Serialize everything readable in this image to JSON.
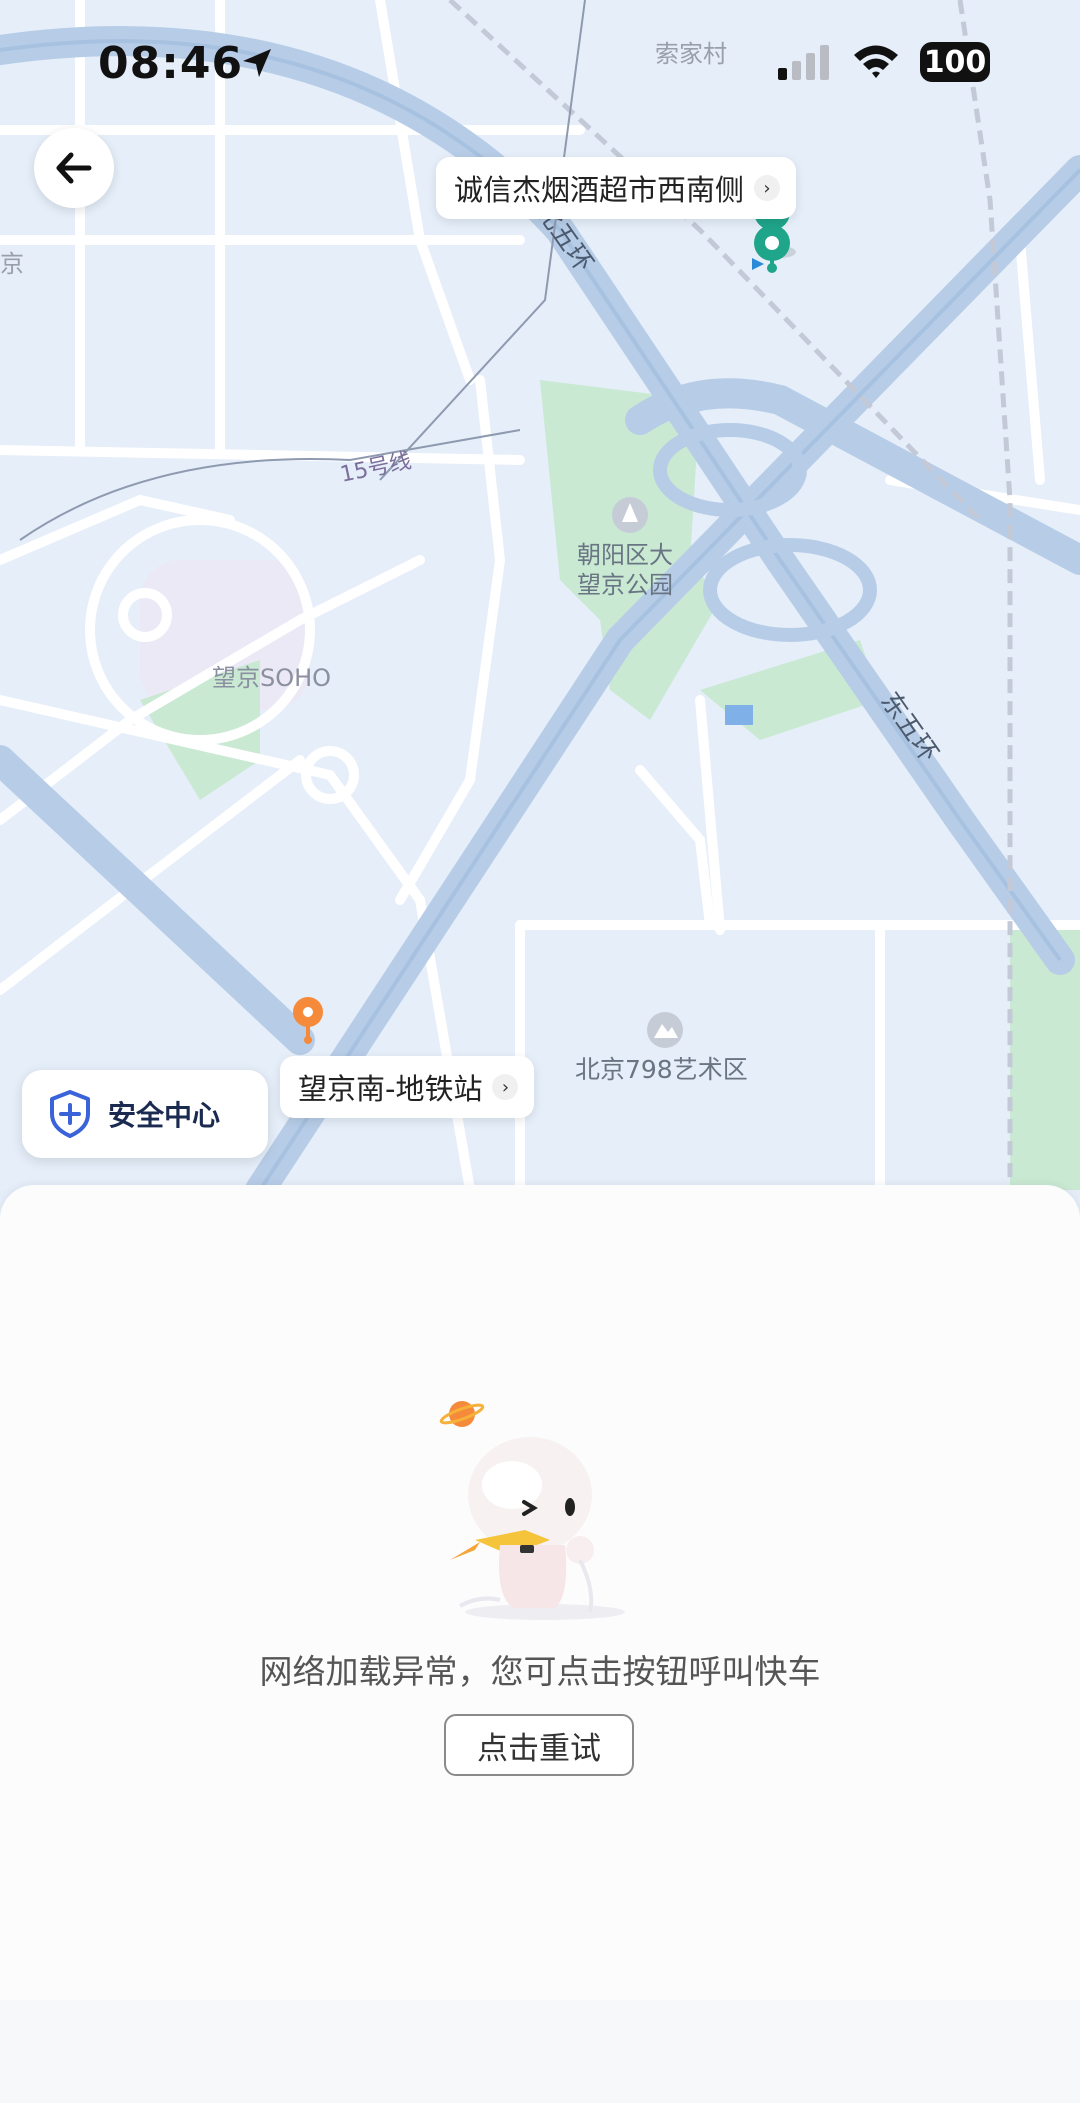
{
  "status_bar": {
    "time": "08:46",
    "battery": "100"
  },
  "map": {
    "labels": {
      "village": "索家村",
      "ring_north": "北五环",
      "ring_east": "东五环",
      "metro_line": "15号线",
      "park_line1": "朝阳区大",
      "park_line2": "望京公园",
      "soho": "望京SOHO",
      "art_district": "北京798艺术区",
      "edge": "京"
    },
    "destination_callout": "诚信杰烟酒超市西南侧",
    "origin_callout": "望京南-地铁站"
  },
  "safety_center": {
    "label": "安全中心"
  },
  "sheet": {
    "error_message": "网络加载异常，您可点击按钮呼叫快车",
    "retry_label": "点击重试"
  },
  "colors": {
    "accent_green": "#1fa58a",
    "origin_orange": "#f58a3a",
    "park_green": "#c9e9d3"
  }
}
